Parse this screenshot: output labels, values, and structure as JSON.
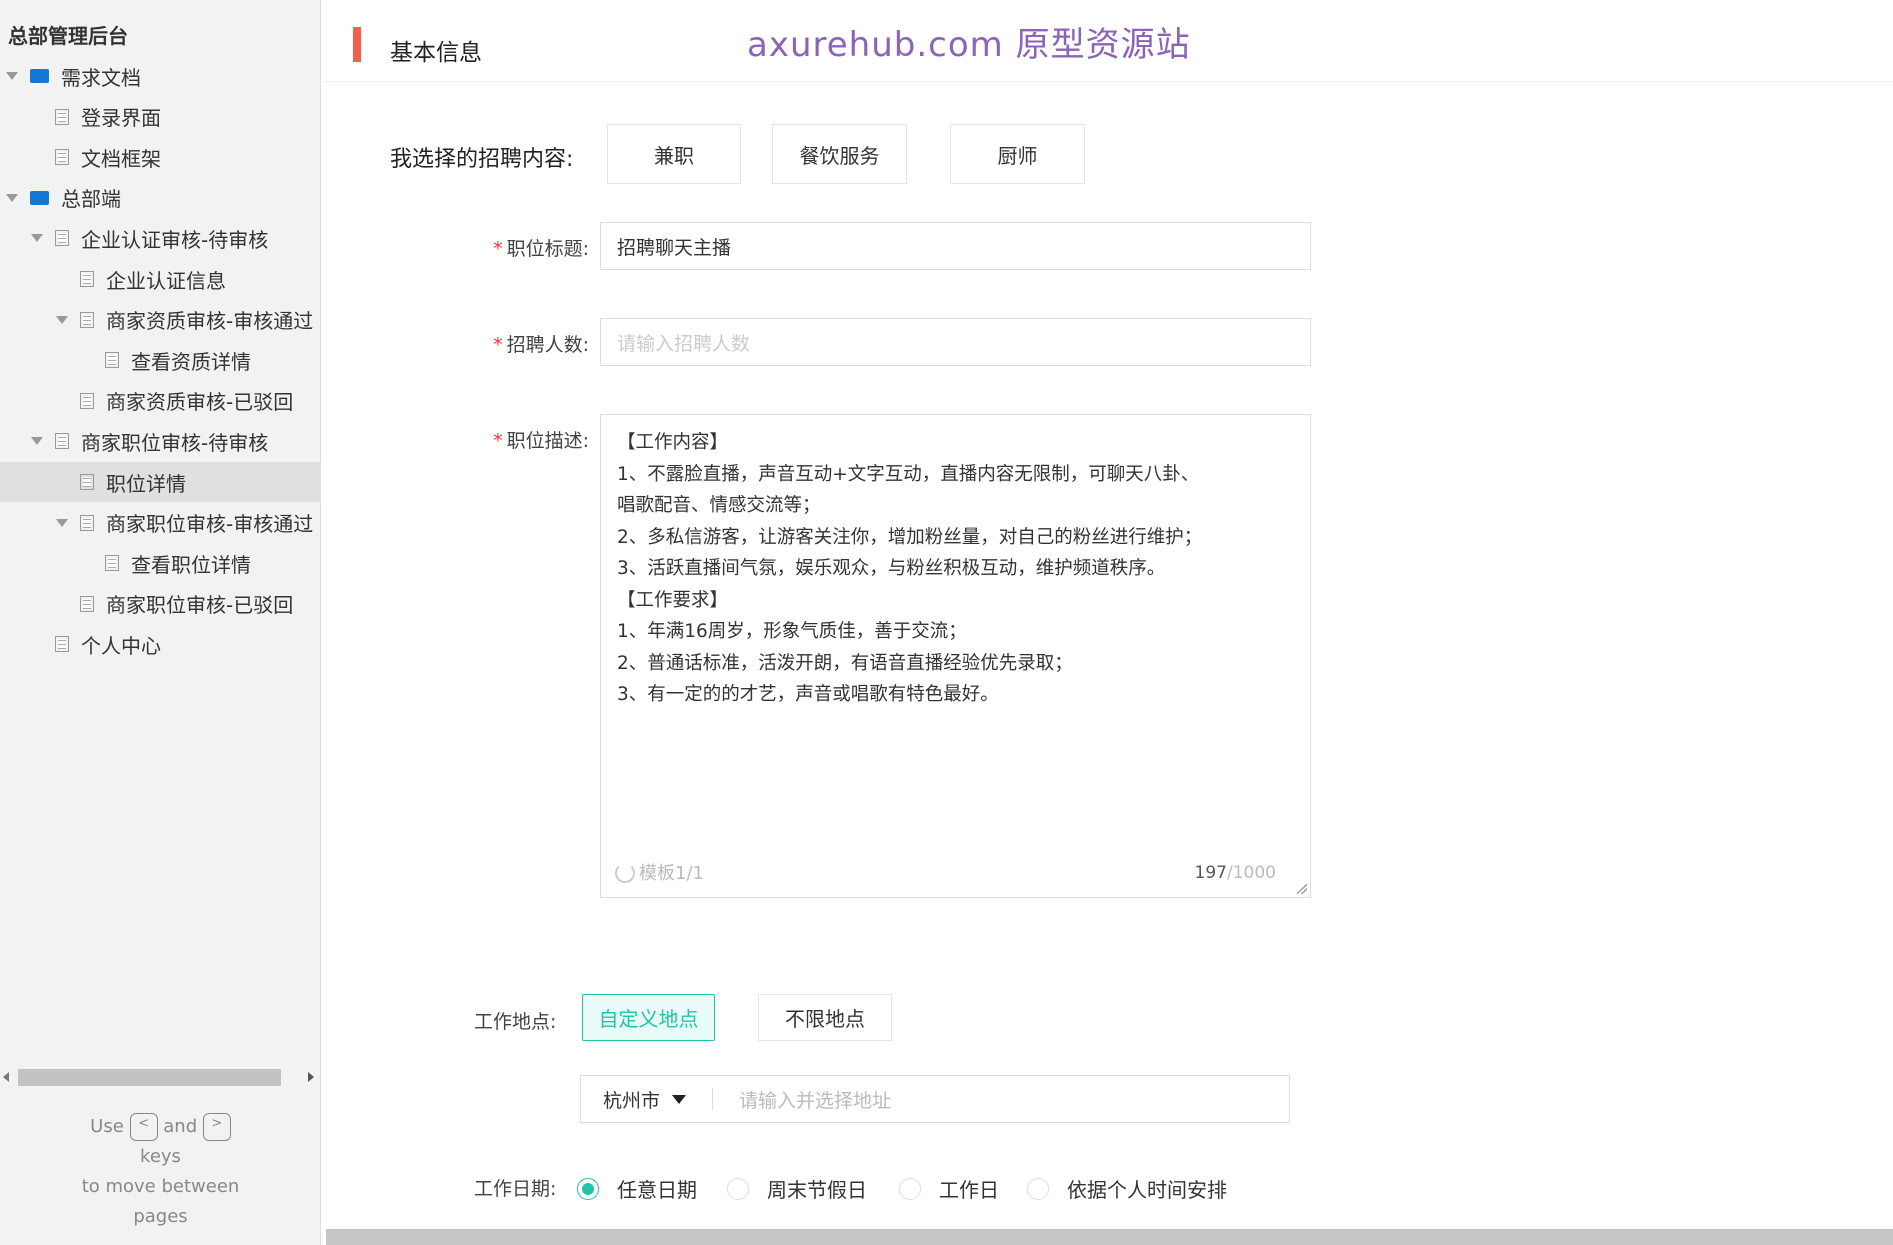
{
  "sidebar": {
    "title": "总部管理后台",
    "items": [
      {
        "label": "需求文档",
        "level": 0,
        "type": "folder",
        "expanded": true
      },
      {
        "label": "登录界面",
        "level": 1,
        "type": "page"
      },
      {
        "label": "文档框架",
        "level": 1,
        "type": "page"
      },
      {
        "label": "总部端",
        "level": 0,
        "type": "folder",
        "expanded": true
      },
      {
        "label": "企业认证审核-待审核",
        "level": 1,
        "type": "page",
        "expanded": true
      },
      {
        "label": "企业认证信息",
        "level": 2,
        "type": "page"
      },
      {
        "label": "商家资质审核-审核通过",
        "level": 2,
        "type": "page",
        "expanded": true
      },
      {
        "label": "查看资质详情",
        "level": 3,
        "type": "page"
      },
      {
        "label": "商家资质审核-已驳回",
        "level": 2,
        "type": "page"
      },
      {
        "label": "商家职位审核-待审核",
        "level": 1,
        "type": "page",
        "expanded": true
      },
      {
        "label": "职位详情",
        "level": 2,
        "type": "page",
        "selected": true
      },
      {
        "label": "商家职位审核-审核通过",
        "level": 2,
        "type": "page",
        "expanded": true
      },
      {
        "label": "查看职位详情",
        "level": 3,
        "type": "page"
      },
      {
        "label": "商家职位审核-已驳回",
        "level": 2,
        "type": "page"
      },
      {
        "label": "个人中心",
        "level": 1,
        "type": "page"
      }
    ],
    "hint": {
      "use": "Use",
      "key_prev": "<",
      "and": "and",
      "key_next": ">",
      "keys": "keys",
      "line2": "to move between",
      "line3": "pages"
    }
  },
  "header": {
    "title": "基本信息",
    "watermark": "axurehub.com 原型资源站"
  },
  "form": {
    "selected_label": "我选择的招聘内容:",
    "selected_tags": [
      "兼职",
      "餐饮服务",
      "厨师"
    ],
    "title_label": "职位标题:",
    "title_value": "招聘聊天主播",
    "count_label": "招聘人数:",
    "count_placeholder": "请输入招聘人数",
    "desc_label": "职位描述:",
    "desc_lines": [
      "【工作内容】",
      "1、不露脸直播，声音互动+文字互动，直播内容无限制，可聊天八卦、",
      "唱歌配音、情感交流等；",
      "2、多私信游客，让游客关注你，增加粉丝量，对自己的粉丝进行维护；",
      "3、活跃直播间气氛，娱乐观众，与粉丝积极互动，维护频道秩序。",
      "【工作要求】",
      "1、年满16周岁，形象气质佳，善于交流；",
      "2、普通话标准，活泼开朗，有语音直播经验优先录取；",
      "3、有一定的的才艺，声音或唱歌有特色最好。"
    ],
    "template": "模板1/1",
    "char_count": "197",
    "char_max": "/1000",
    "location_label": "工作地点:",
    "location_options": [
      "自定义地点",
      "不限地点"
    ],
    "location_selected": "自定义地点",
    "city": "杭州市",
    "address_placeholder": "请输入并选择地址",
    "date_label": "工作日期:",
    "date_options": [
      "任意日期",
      "周末节假日",
      "工作日",
      "依据个人时间安排"
    ],
    "date_selected": "任意日期"
  },
  "colors": {
    "accent": "#20c4a8",
    "header_bar": "#f25f4c",
    "watermark": "#8c63b8",
    "folder": "#1477d4"
  }
}
